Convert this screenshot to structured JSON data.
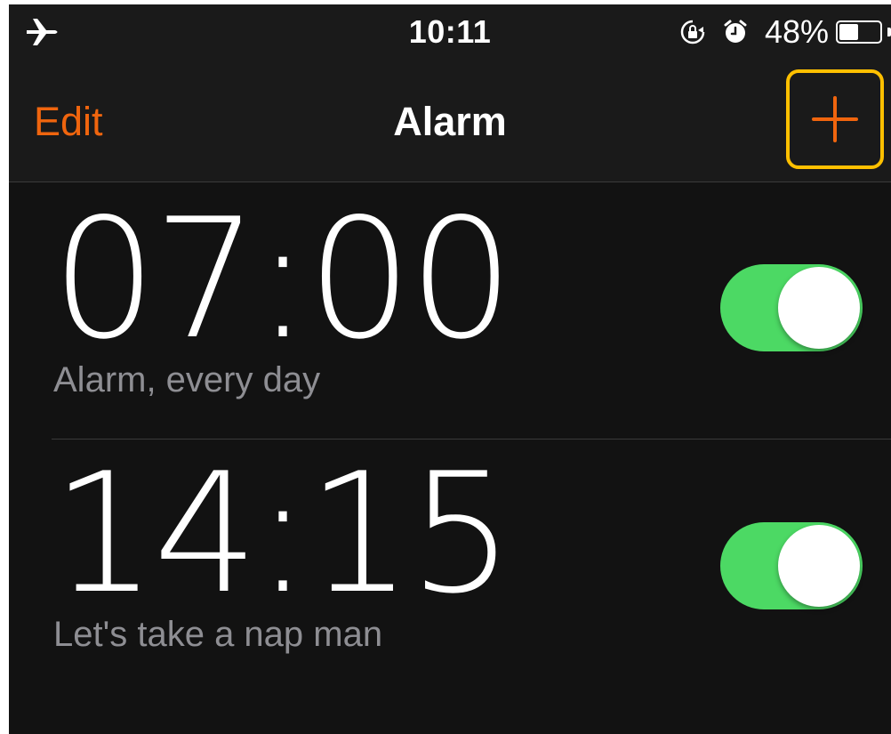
{
  "status_bar": {
    "time": "10:11",
    "battery_text": "48%",
    "battery_level": 0.48,
    "icons": [
      "airplane-icon",
      "rotation-lock-icon",
      "alarm-clock-icon",
      "battery-icon"
    ]
  },
  "nav": {
    "edit_label": "Edit",
    "title": "Alarm",
    "add_icon": "plus-icon"
  },
  "alarms": [
    {
      "time": "07:00",
      "label": "Alarm, every day",
      "enabled": true
    },
    {
      "time": "14:15",
      "label": "Let's take a nap man",
      "enabled": true
    }
  ],
  "colors": {
    "accent": "#f0650e",
    "toggle_on": "#4cd964",
    "highlight": "#ffc000",
    "background": "#121212",
    "secondary_text": "#8e8e93"
  }
}
